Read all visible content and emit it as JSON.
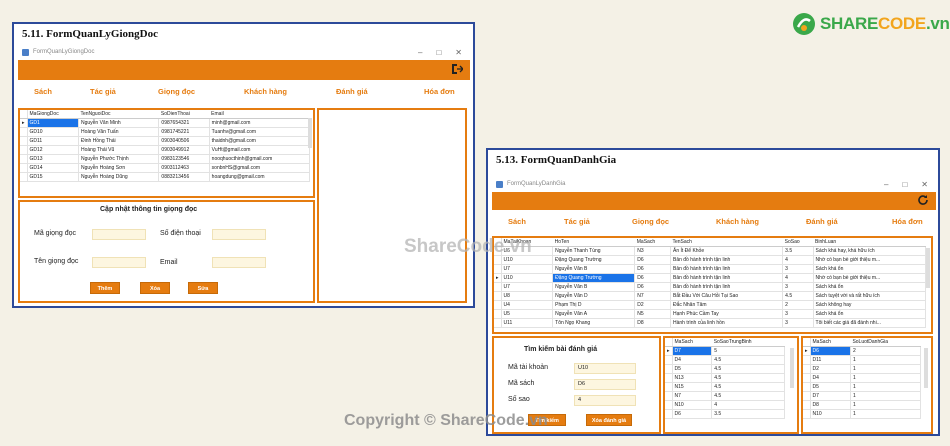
{
  "logo": {
    "text_share": "SHARE",
    "text_code": "CODE",
    "text_suffix": ".vn"
  },
  "watermarks": {
    "center": "ShareCode.vn",
    "bottom": "Copyright © ShareCode.vn"
  },
  "form_left": {
    "caption": "5.11. FormQuanLyGiongDoc",
    "window_title": "FormQuanLyGiongDoc",
    "menu": [
      "Sách",
      "Tác giả",
      "Giọng đọc",
      "Khách hàng",
      "Đánh giá",
      "Hóa đơn"
    ],
    "grid": {
      "columns": [
        "MaGiongDoc",
        "TenNguoiDoc",
        "SoDienThoai",
        "Email"
      ],
      "rows": [
        [
          "GD1",
          "Nguyễn Văn Minh",
          "0987654321",
          "minh@gmail.com"
        ],
        [
          "GD10",
          "Hoàng Văn Tuấn",
          "0981745221",
          "Tuanhv@gmail.com"
        ],
        [
          "GD11",
          "Đinh Hồng Thái",
          "0903040506",
          "thaidnh@gmail.com"
        ],
        [
          "GD12",
          "Hoàng Thái Vũ",
          "0903049912",
          "VuHt@gmail.com"
        ],
        [
          "GD13",
          "Nguyễn Phước Thịnh",
          "0983123546",
          "nooqhuocthinh@gmail.com"
        ],
        [
          "GD14",
          "Nguyễn Hoàng Sơn",
          "0903112463",
          "sonbnHS@gmail.com"
        ],
        [
          "GD15",
          "Nguyễn Hoàng Dũng",
          "0883213456",
          "hoangdung@gmail.com"
        ]
      ]
    },
    "form_title": "Cập nhật thông tin giọng đọc",
    "labels": {
      "ma": "Mã giọng đọc",
      "sdt": "Số điện thoại",
      "ten": "Tên giọng đọc",
      "email": "Email"
    },
    "buttons": {
      "them": "Thêm",
      "xoa": "Xóa",
      "sua": "Sửa"
    }
  },
  "form_right": {
    "caption": "5.13. FormQuanDanhGia",
    "window_title": "FormQuanLyDanhGia",
    "menu": [
      "Sách",
      "Tác giả",
      "Giọng đọc",
      "Khách hàng",
      "Đánh giá",
      "Hóa đơn"
    ],
    "grid": {
      "columns": [
        "MaTaiKhoan",
        "HoTen",
        "MaSach",
        "TenSach",
        "SoSao",
        "BinhLuan"
      ],
      "rows": [
        [
          "U6",
          "Nguyễn Thanh Tùng",
          "N3",
          "Ăn Ít Để Khỏe",
          "3.5",
          "Sách khá hay, khá hữu ích"
        ],
        [
          "U10",
          "Đặng Quang Trường",
          "D6",
          "Bản đồ hành trình tận linh",
          "4",
          "Nhờ có bạn bè giới thiệu m..."
        ],
        [
          "U7",
          "Nguyễn Văn B",
          "D6",
          "Bản đồ hành trình tận linh",
          "3",
          "Sách khá ổn"
        ],
        [
          "U10",
          "Đặng Quang Trường",
          "D6",
          "Bản đồ hành trình tận linh",
          "4",
          "Nhờ có bạn bè giới thiệu m..."
        ],
        [
          "U7",
          "Nguyễn Văn B",
          "D6",
          "Bản đồ hành trình tận linh",
          "3",
          "Sách khá ổn"
        ],
        [
          "U8",
          "Nguyễn Văn D",
          "N7",
          "Bắt Đầu Với Câu Hỏi Tại Sao",
          "4.5",
          "Sách tuyệt vời và rất hữu ích"
        ],
        [
          "U4",
          "Phạm Thị D",
          "D2",
          "Đắc Nhân Tâm",
          "2",
          "Sách không hay"
        ],
        [
          "U5",
          "Nguyễn Văn A",
          "N5",
          "Hạnh Phúc Cầm Tay",
          "3",
          "Sách khá ổn"
        ],
        [
          "U11",
          "Tôn Ngọ Khang",
          "D8",
          "Hành trình của linh hồn",
          "3",
          "Tôi biết các giá đã đánh nhi..."
        ]
      ]
    },
    "search_title": "Tìm kiếm bài đánh giá",
    "labels": {
      "tk": "Mã tài khoản",
      "ms": "Mã sách",
      "ss": "Số sao"
    },
    "values": {
      "tk": "U10",
      "ms": "D6",
      "ss": "4"
    },
    "buttons": {
      "tim": "Tìm kiếm",
      "xoa": "Xóa đánh giá"
    },
    "grid2": {
      "columns": [
        "MaSach",
        "SoSaoTrungBinh"
      ],
      "rows": [
        [
          "D7",
          "5"
        ],
        [
          "D4",
          "4.5"
        ],
        [
          "D5",
          "4.5"
        ],
        [
          "N13",
          "4.5"
        ],
        [
          "N15",
          "4.5"
        ],
        [
          "N7",
          "4.5"
        ],
        [
          "N10",
          "4"
        ],
        [
          "D6",
          "3.5"
        ]
      ]
    },
    "grid3": {
      "columns": [
        "MaSach",
        "SoLuotDanhGia"
      ],
      "rows": [
        [
          "D6",
          "2"
        ],
        [
          "D11",
          "1"
        ],
        [
          "D2",
          "1"
        ],
        [
          "D4",
          "1"
        ],
        [
          "D5",
          "1"
        ],
        [
          "D7",
          "1"
        ],
        [
          "D8",
          "1"
        ],
        [
          "N10",
          "1"
        ]
      ]
    }
  }
}
